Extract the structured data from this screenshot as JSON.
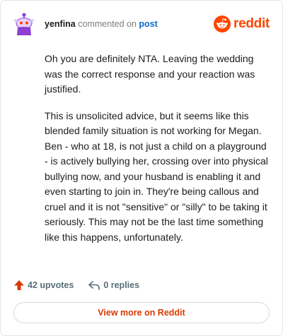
{
  "comment": {
    "username": "yenfina",
    "action_text": "commented on",
    "post_link_text": "post",
    "paragraphs": [
      "Oh you are definitely NTA. Leaving the wedding was the correct response and your reaction was justified.",
      "This is unsolicited advice, but it seems like this blended family situation is not working for Megan. Ben - who at 18, is not just a child on a playground - is actively bullying her, crossing over into physical bullying now, and your husband is enabling it and even starting to join in. They're being callous and cruel and it is not \"sensitive\" or \"silly\" to be taking it seriously. This may not be the last time something like this happens, unfortunately."
    ]
  },
  "brand": {
    "wordmark": "reddit",
    "icon": "reddit-snoo-icon",
    "color": "#ff4500"
  },
  "actions": {
    "upvotes_label": "42 upvotes",
    "replies_label": "0 replies",
    "upvote_icon": "upvote-arrow-icon",
    "reply_icon": "reply-arrow-icon",
    "upvote_color": "#d93900"
  },
  "footer": {
    "view_more_label": "View more on Reddit"
  },
  "avatar": {
    "icon": "snoo-avatar-icon",
    "color": "#8c3fd1"
  }
}
